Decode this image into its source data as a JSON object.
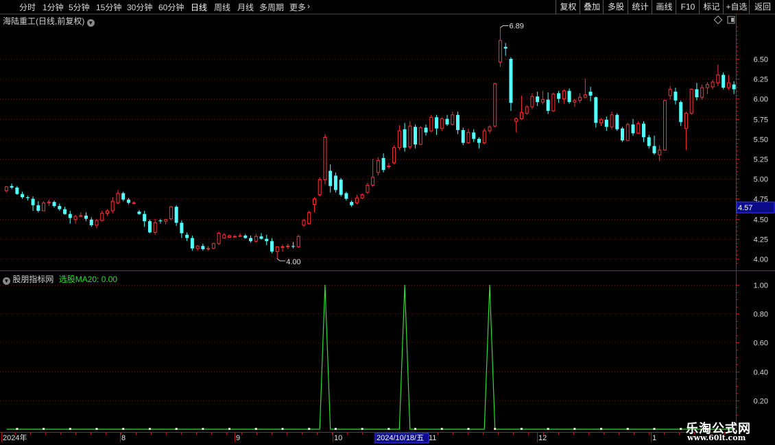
{
  "toolbar": {
    "periods": [
      "分时",
      "1分钟",
      "5分钟",
      "15分钟",
      "30分钟",
      "60分钟",
      "日线",
      "周线",
      "月线",
      "多周期",
      "更多"
    ],
    "active_period": "日线",
    "right_buttons": [
      "复权",
      "叠加",
      "多股",
      "统计",
      "画线",
      "F10",
      "标记",
      "+自选",
      "返回"
    ]
  },
  "main_title": "海陆重工(日线,前复权)",
  "indicator": {
    "name": "股朋指标网",
    "label": "选股MA20: 0.00"
  },
  "price_tag": "4.57",
  "hi_label": "6.89",
  "lo_label": "4.00",
  "cursor_date": "2024/10/18/五",
  "watermark": {
    "line1": "乐淘公式网",
    "line2": "www.60lt.com"
  },
  "colors": {
    "up": "#ff3232",
    "down": "#54ffff",
    "indicator": "#2fdc2f",
    "grid": "#7a1010",
    "axis": "#b01818"
  },
  "chart_data": [
    {
      "type": "candlestick",
      "title": "海陆重工(日线,前复权)",
      "ylim": [
        3.9,
        6.95
      ],
      "y_ticks": [
        4.0,
        4.25,
        4.5,
        4.75,
        5.0,
        5.25,
        5.5,
        5.75,
        6.0,
        6.25,
        6.5
      ],
      "x_labels": [
        "2024年",
        "8",
        "9",
        "10",
        "11",
        "12",
        "1"
      ],
      "series": [
        {
          "name": "K",
          "ohlc": [
            [
              4.85,
              4.91,
              4.83,
              4.9
            ],
            [
              4.91,
              4.94,
              4.87,
              4.89
            ],
            [
              4.89,
              4.91,
              4.8,
              4.81
            ],
            [
              4.81,
              4.84,
              4.75,
              4.77
            ],
            [
              4.77,
              4.79,
              4.73,
              4.76
            ],
            [
              4.75,
              4.78,
              4.6,
              4.67
            ],
            [
              4.67,
              4.72,
              4.58,
              4.6
            ],
            [
              4.6,
              4.72,
              4.6,
              4.7
            ],
            [
              4.7,
              4.74,
              4.66,
              4.71
            ],
            [
              4.71,
              4.73,
              4.64,
              4.66
            ],
            [
              4.66,
              4.69,
              4.6,
              4.62
            ],
            [
              4.62,
              4.65,
              4.55,
              4.56
            ],
            [
              4.56,
              4.6,
              4.44,
              4.51
            ],
            [
              4.49,
              4.55,
              4.44,
              4.53
            ],
            [
              4.53,
              4.58,
              4.52,
              4.54
            ],
            [
              4.54,
              4.58,
              4.47,
              4.5
            ],
            [
              4.49,
              4.52,
              4.4,
              4.42
            ],
            [
              4.42,
              4.5,
              4.38,
              4.48
            ],
            [
              4.48,
              4.6,
              4.47,
              4.57
            ],
            [
              4.57,
              4.62,
              4.54,
              4.6
            ],
            [
              4.6,
              4.77,
              4.57,
              4.72
            ],
            [
              4.7,
              4.86,
              4.68,
              4.82
            ],
            [
              4.82,
              4.84,
              4.72,
              4.74
            ],
            [
              4.74,
              4.76,
              4.68,
              4.7
            ],
            [
              4.7,
              4.72,
              4.68,
              4.7
            ],
            [
              4.59,
              4.61,
              4.55,
              4.56
            ],
            [
              4.56,
              4.6,
              4.4,
              4.47
            ],
            [
              4.47,
              4.49,
              4.32,
              4.33
            ],
            [
              4.33,
              4.5,
              4.3,
              4.45
            ],
            [
              4.48,
              4.5,
              4.44,
              4.47
            ],
            [
              4.47,
              4.5,
              4.43,
              4.49
            ],
            [
              4.5,
              4.66,
              4.48,
              4.65
            ],
            [
              4.65,
              4.67,
              4.41,
              4.45
            ],
            [
              4.45,
              4.48,
              4.26,
              4.32
            ],
            [
              4.3,
              4.33,
              4.22,
              4.26
            ],
            [
              4.26,
              4.29,
              4.1,
              4.13
            ],
            [
              4.13,
              4.17,
              4.1,
              4.16
            ],
            [
              4.16,
              4.19,
              4.1,
              4.12
            ],
            [
              4.12,
              4.16,
              4.1,
              4.13
            ],
            [
              4.13,
              4.2,
              4.12,
              4.19
            ],
            [
              4.19,
              4.34,
              4.17,
              4.32
            ],
            [
              4.26,
              4.32,
              4.25,
              4.3
            ],
            [
              4.27,
              4.3,
              4.26,
              4.29
            ],
            [
              4.28,
              4.3,
              4.27,
              4.28
            ],
            [
              4.28,
              4.32,
              4.27,
              4.29
            ],
            [
              4.29,
              4.31,
              4.25,
              4.26
            ],
            [
              4.26,
              4.29,
              4.2,
              4.22
            ],
            [
              4.22,
              4.31,
              4.2,
              4.28
            ],
            [
              4.28,
              4.32,
              4.24,
              4.25
            ],
            [
              4.25,
              4.3,
              4.17,
              4.22
            ],
            [
              4.22,
              4.26,
              4.07,
              4.09
            ],
            [
              4.09,
              4.15,
              4.0,
              4.15
            ],
            [
              4.14,
              4.18,
              4.09,
              4.15
            ],
            [
              4.15,
              4.19,
              4.12,
              4.16
            ],
            [
              4.16,
              4.21,
              4.13,
              4.15
            ],
            [
              4.15,
              4.3,
              4.14,
              4.28
            ],
            [
              4.42,
              4.5,
              4.4,
              4.48
            ],
            [
              4.44,
              4.6,
              4.43,
              4.58
            ],
            [
              4.68,
              4.77,
              4.58,
              4.75
            ],
            [
              4.8,
              5.02,
              4.78,
              4.99
            ],
            [
              4.99,
              5.56,
              4.93,
              5.52
            ],
            [
              5.1,
              5.18,
              4.83,
              4.91
            ],
            [
              5.04,
              5.08,
              4.83,
              4.86
            ],
            [
              4.99,
              5.01,
              4.78,
              4.8
            ],
            [
              4.82,
              4.84,
              4.73,
              4.75
            ],
            [
              4.71,
              4.73,
              4.65,
              4.67
            ],
            [
              4.7,
              4.8,
              4.68,
              4.76
            ],
            [
              4.76,
              4.82,
              4.75,
              4.8
            ],
            [
              4.83,
              4.95,
              4.81,
              4.92
            ],
            [
              4.92,
              5.25,
              4.9,
              5.02
            ],
            [
              5.08,
              5.27,
              5.04,
              5.23
            ],
            [
              5.26,
              5.32,
              5.08,
              5.11
            ],
            [
              5.15,
              5.2,
              5.13,
              5.16
            ],
            [
              5.2,
              5.42,
              5.18,
              5.39
            ],
            [
              5.39,
              5.67,
              5.36,
              5.6
            ],
            [
              5.62,
              5.7,
              5.34,
              5.39
            ],
            [
              5.4,
              5.72,
              5.37,
              5.66
            ],
            [
              5.65,
              5.68,
              5.38,
              5.43
            ],
            [
              5.43,
              5.66,
              5.42,
              5.64
            ],
            [
              5.64,
              5.68,
              5.54,
              5.58
            ],
            [
              5.6,
              5.8,
              5.58,
              5.77
            ],
            [
              5.77,
              5.8,
              5.55,
              5.63
            ],
            [
              5.63,
              5.77,
              5.6,
              5.75
            ],
            [
              5.75,
              5.8,
              5.66,
              5.68
            ],
            [
              5.68,
              5.84,
              5.67,
              5.8
            ],
            [
              5.8,
              5.84,
              5.56,
              5.61
            ],
            [
              5.61,
              5.64,
              5.42,
              5.45
            ],
            [
              5.45,
              5.63,
              5.44,
              5.58
            ],
            [
              5.58,
              5.62,
              5.46,
              5.5
            ],
            [
              5.5,
              5.52,
              5.38,
              5.45
            ],
            [
              5.45,
              5.63,
              5.43,
              5.6
            ],
            [
              5.6,
              5.67,
              5.57,
              5.65
            ],
            [
              5.66,
              6.2,
              5.64,
              6.19
            ],
            [
              6.46,
              6.89,
              6.4,
              6.73
            ],
            [
              6.65,
              6.7,
              6.54,
              6.63
            ],
            [
              6.5,
              6.52,
              5.85,
              5.95
            ],
            [
              5.72,
              5.77,
              5.58,
              5.75
            ],
            [
              5.75,
              6.04,
              5.74,
              5.83
            ],
            [
              5.82,
              5.92,
              5.8,
              5.9
            ],
            [
              5.9,
              6.07,
              5.87,
              6.03
            ],
            [
              6.03,
              6.09,
              5.91,
              5.96
            ],
            [
              5.96,
              6.1,
              5.93,
              5.99
            ],
            [
              5.99,
              6.08,
              5.81,
              5.85
            ],
            [
              5.85,
              6.08,
              5.84,
              6.06
            ],
            [
              6.07,
              6.1,
              5.95,
              6.0
            ],
            [
              6.0,
              6.12,
              5.94,
              6.1
            ],
            [
              6.1,
              6.13,
              5.94,
              5.96
            ],
            [
              5.96,
              6.0,
              5.9,
              5.98
            ],
            [
              5.98,
              6.07,
              5.95,
              6.02
            ],
            [
              6.02,
              6.25,
              6.01,
              6.05
            ],
            [
              6.09,
              6.15,
              5.97,
              6.04
            ],
            [
              6.02,
              6.03,
              5.64,
              5.7
            ],
            [
              5.7,
              5.76,
              5.66,
              5.74
            ],
            [
              5.74,
              5.78,
              5.6,
              5.65
            ],
            [
              5.65,
              5.84,
              5.62,
              5.8
            ],
            [
              5.8,
              5.82,
              5.6,
              5.62
            ],
            [
              5.63,
              5.65,
              5.46,
              5.48
            ],
            [
              5.48,
              5.7,
              5.47,
              5.68
            ],
            [
              5.68,
              5.75,
              5.54,
              5.57
            ],
            [
              5.57,
              5.72,
              5.56,
              5.69
            ],
            [
              5.69,
              5.72,
              5.46,
              5.52
            ],
            [
              5.52,
              5.55,
              5.38,
              5.41
            ],
            [
              5.41,
              5.54,
              5.3,
              5.32
            ],
            [
              5.3,
              5.42,
              5.22,
              5.36
            ],
            [
              5.36,
              5.98,
              5.35,
              5.98
            ],
            [
              6.04,
              6.16,
              5.99,
              6.12
            ],
            [
              6.09,
              6.14,
              5.93,
              5.98
            ],
            [
              5.96,
              5.98,
              5.66,
              5.71
            ],
            [
              5.63,
              5.84,
              5.36,
              5.82
            ],
            [
              5.82,
              6.13,
              5.8,
              6.12
            ],
            [
              6.12,
              6.2,
              5.98,
              6.02
            ],
            [
              6.02,
              6.18,
              5.99,
              6.14
            ],
            [
              6.14,
              6.21,
              6.06,
              6.18
            ],
            [
              6.15,
              6.24,
              6.12,
              6.21
            ],
            [
              6.2,
              6.43,
              6.16,
              6.3
            ],
            [
              6.3,
              6.33,
              6.12,
              6.14
            ],
            [
              6.14,
              6.3,
              6.11,
              6.2
            ],
            [
              6.18,
              6.22,
              6.06,
              6.12
            ]
          ]
        }
      ]
    },
    {
      "type": "line",
      "title": "股朋指标网",
      "ylim": [
        0.1,
        1.06
      ],
      "y_ticks": [
        0.2,
        0.4,
        0.6,
        0.8,
        1.0
      ],
      "series": [
        {
          "name": "选股MA20",
          "spike_indices": [
            60,
            75,
            91
          ],
          "values_at_spike": 1.0,
          "baseline": 0.0
        }
      ]
    }
  ]
}
